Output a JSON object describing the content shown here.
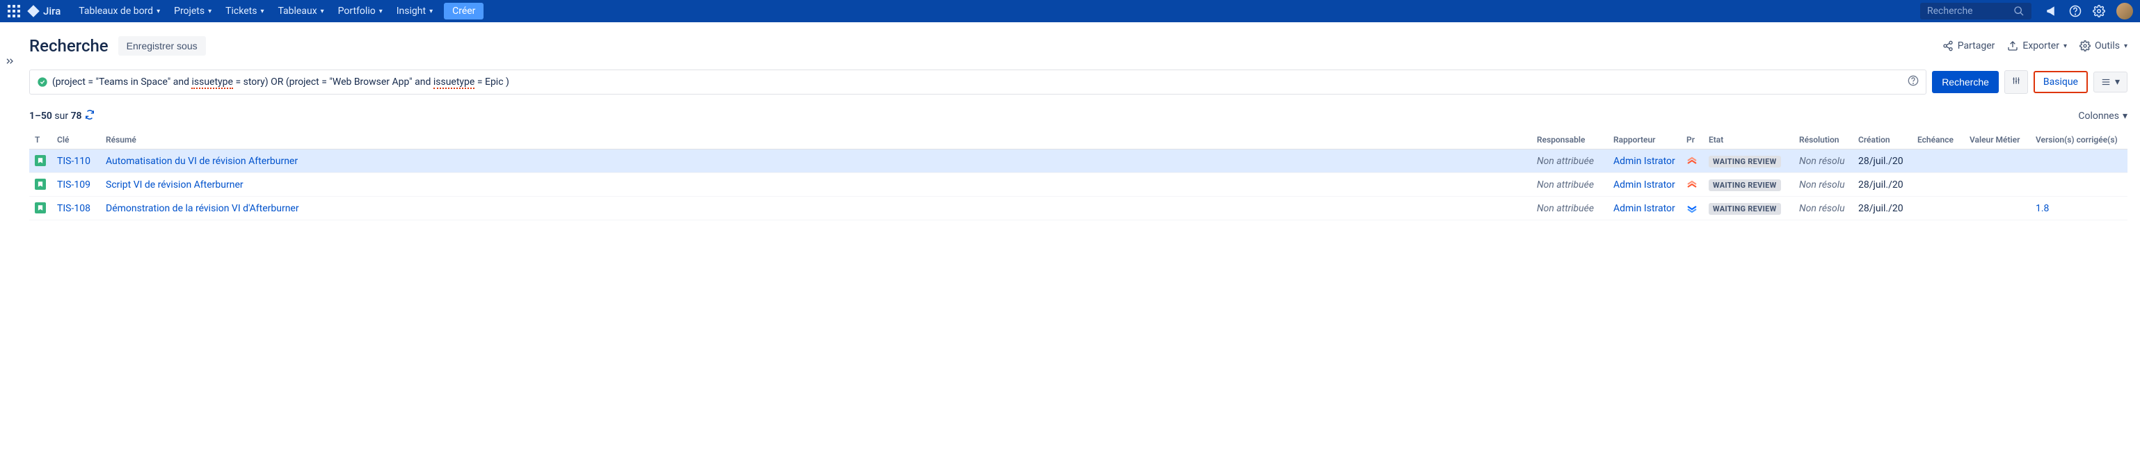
{
  "topbar": {
    "logo_text": "Jira",
    "nav": [
      "Tableaux de bord",
      "Projets",
      "Tickets",
      "Tableaux",
      "Portfolio",
      "Insight"
    ],
    "create": "Créer",
    "search_placeholder": "Recherche"
  },
  "page": {
    "title": "Recherche",
    "save_as": "Enregistrer sous",
    "share": "Partager",
    "export": "Exporter",
    "tools": "Outils"
  },
  "jql": {
    "p1": "(project = \"Teams in Space\" and ",
    "w1": "issuetype",
    "p2": " = story) OR (project = \"Web Browser App\" and ",
    "w2": "issuetype",
    "p3": " = Epic )",
    "search_btn": "Recherche",
    "basic": "Basique"
  },
  "results": {
    "range": "1–50",
    "sur": "sur",
    "total": "78",
    "columns": "Colonnes"
  },
  "table": {
    "headers": {
      "type": "T",
      "key": "Clé",
      "summary": "Résumé",
      "assignee": "Responsable",
      "reporter": "Rapporteur",
      "priority": "Pr",
      "status": "Etat",
      "resolution": "Résolution",
      "created": "Création",
      "due": "Echéance",
      "business": "Valeur Métier",
      "fixversion": "Version(s) corrigée(s)"
    },
    "rows": [
      {
        "key": "TIS-110",
        "summary": "Automatisation du VI de révision Afterburner",
        "assignee": "Non attribuée",
        "reporter": "Admin Istrator",
        "priority": "high",
        "status": "WAITING REVIEW",
        "resolution": "Non résolu",
        "created": "28/juil./20",
        "due": "",
        "business": "",
        "fixversion": ""
      },
      {
        "key": "TIS-109",
        "summary": "Script VI de révision Afterburner",
        "assignee": "Non attribuée",
        "reporter": "Admin Istrator",
        "priority": "high",
        "status": "WAITING REVIEW",
        "resolution": "Non résolu",
        "created": "28/juil./20",
        "due": "",
        "business": "",
        "fixversion": ""
      },
      {
        "key": "TIS-108",
        "summary": "Démonstration de la révision VI d'Afterburner",
        "assignee": "Non attribuée",
        "reporter": "Admin Istrator",
        "priority": "low",
        "status": "WAITING REVIEW",
        "resolution": "Non résolu",
        "created": "28/juil./20",
        "due": "",
        "business": "",
        "fixversion": "1.8"
      }
    ]
  }
}
